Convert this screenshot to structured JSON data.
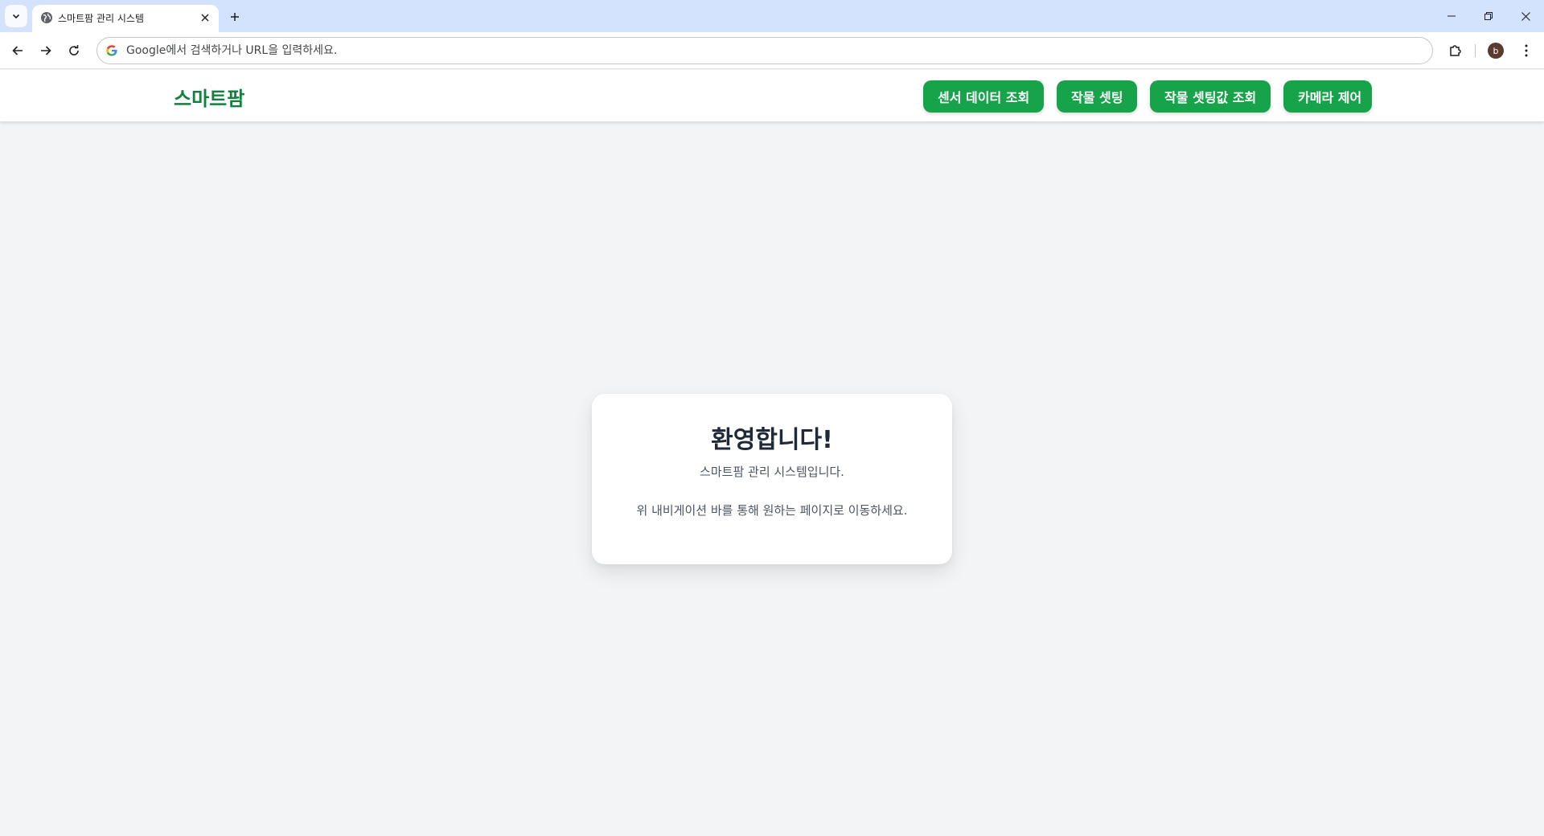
{
  "browser": {
    "tab_title": "스마트팜 관리 시스템",
    "omnibox_placeholder": "Google에서 검색하거나 URL을 입력하세요.",
    "profile_initial": "b"
  },
  "header": {
    "brand": "스마트팜",
    "nav": [
      {
        "label": "센서 데이터 조회"
      },
      {
        "label": "작물 셋팅"
      },
      {
        "label": "작물 셋팅값 조회"
      },
      {
        "label": "카메라 제어"
      }
    ]
  },
  "welcome": {
    "title": "환영합니다!",
    "subtitle": "스마트팜 관리 시스템입니다.",
    "hint": "위 내비게이션 바를 통해 원하는 페이지로 이동하세요."
  },
  "colors": {
    "brand": "#15803d",
    "button": "#16a34a",
    "page_bg": "#f3f4f6"
  }
}
